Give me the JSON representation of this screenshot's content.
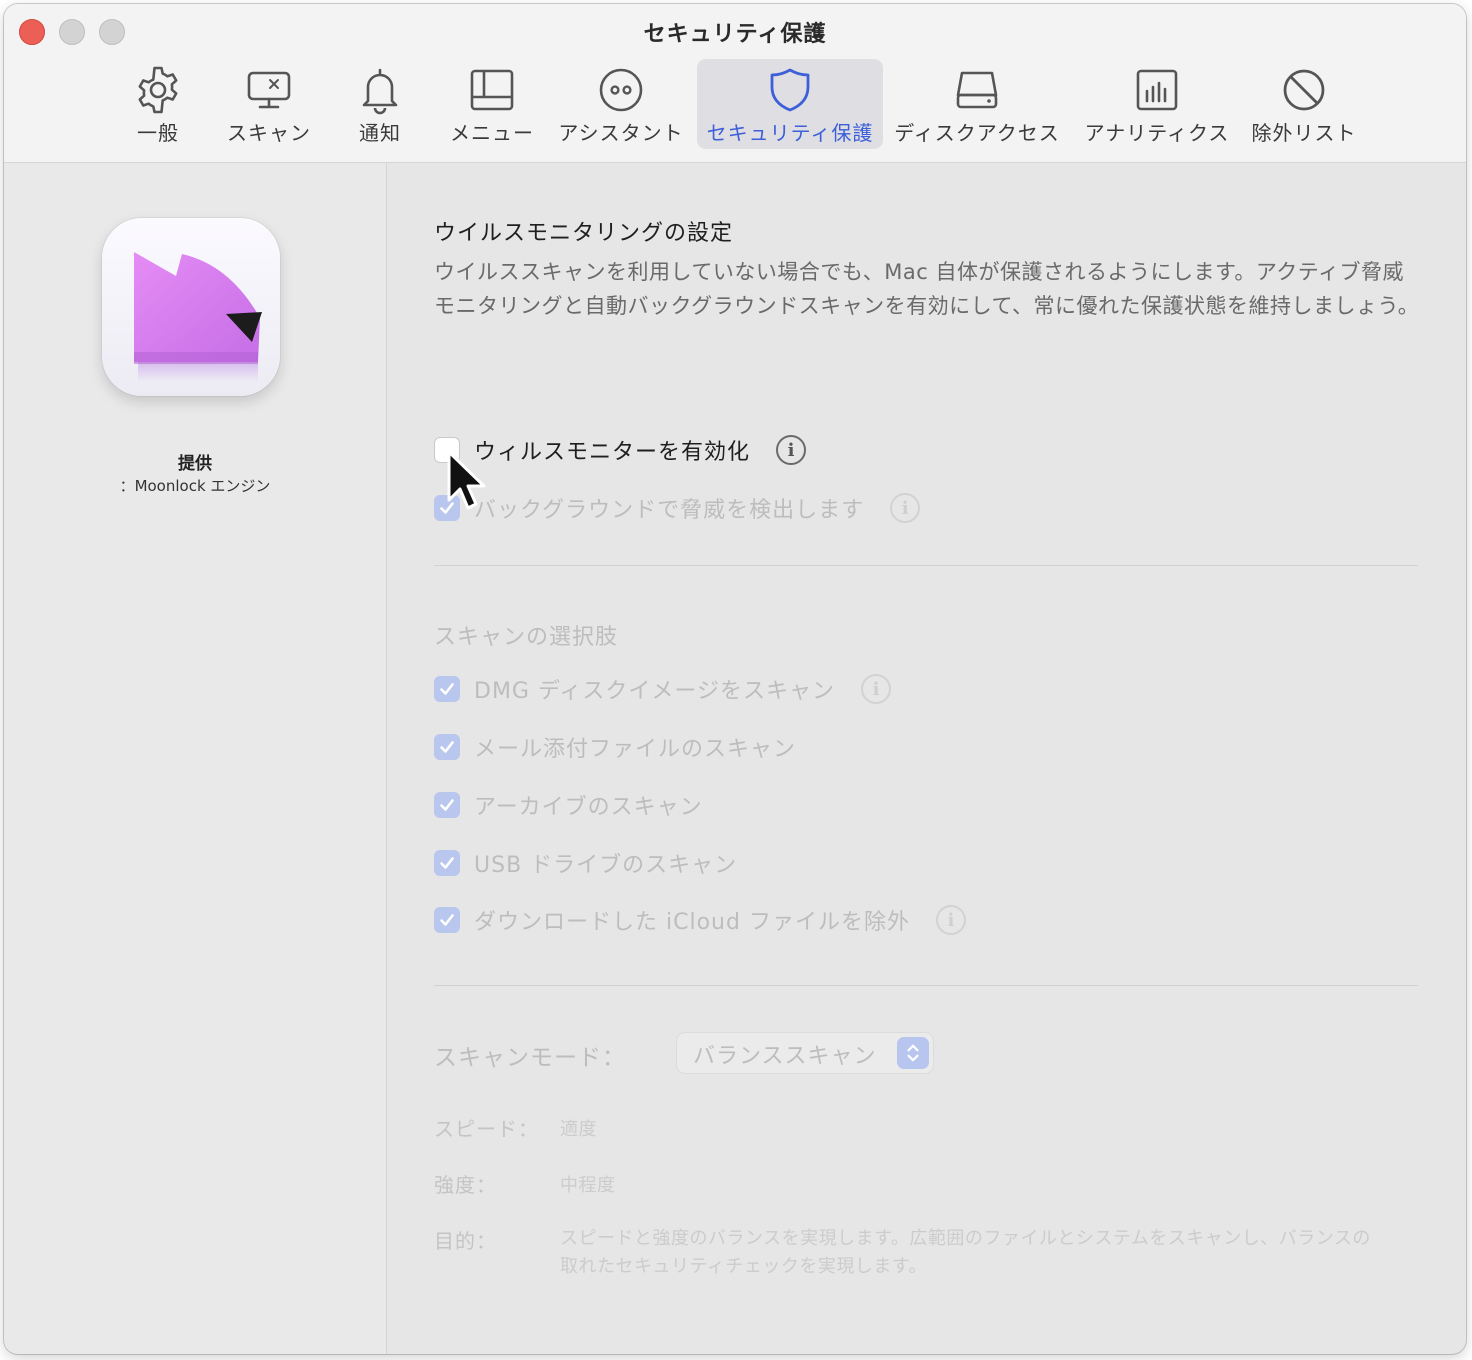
{
  "window": {
    "title": "セキュリティ保護"
  },
  "tabs": [
    {
      "label": "一般",
      "icon": "gear-icon"
    },
    {
      "label": "スキャン",
      "icon": "scan-monitor-icon"
    },
    {
      "label": "通知",
      "icon": "bell-icon"
    },
    {
      "label": "メニュー",
      "icon": "menu-icon"
    },
    {
      "label": "アシスタント",
      "icon": "assistant-icon"
    },
    {
      "label": "セキュリティ保護",
      "icon": "shield-icon",
      "active": true
    },
    {
      "label": "ディスクアクセス",
      "icon": "disk-icon"
    },
    {
      "label": "アナリティクス",
      "icon": "analytics-icon"
    },
    {
      "label": "除外リスト",
      "icon": "prohibited-icon"
    }
  ],
  "sidebar": {
    "provided_label": "提供",
    "provided_engine": "：Moonlock エンジン"
  },
  "virus_monitoring": {
    "title": "ウイルスモニタリングの設定",
    "description": "ウイルススキャンを利用していない場合でも、Mac 自体が保護されるようにします。アクティブ脅威モニタリングと自動バックグラウンドスキャンを有効にして、常に優れた保護状態を維持しましょう。",
    "enable_label": "ウィルスモニターを有効化",
    "enable_checked": false,
    "background_label": "バックグラウンドで脅威を検出します",
    "background_checked": true
  },
  "scan_options": {
    "title": "スキャンの選択肢",
    "items": [
      {
        "label": "DMG ディスクイメージをスキャン",
        "checked": true,
        "info": true
      },
      {
        "label": "メール添付ファイルのスキャン",
        "checked": true,
        "info": false
      },
      {
        "label": "アーカイブのスキャン",
        "checked": true,
        "info": false
      },
      {
        "label": "USB ドライブのスキャン",
        "checked": true,
        "info": false
      },
      {
        "label": "ダウンロードした iCloud ファイルを除外",
        "checked": true,
        "info": true
      }
    ]
  },
  "scan_mode": {
    "label": "スキャンモード：",
    "selected": "バランススキャン",
    "speed_label": "スピード：",
    "speed_value": "適度",
    "strength_label": "強度：",
    "strength_value": "中程度",
    "purpose_label": "目的：",
    "purpose_value": "スピードと強度のバランスを実現します。広範囲のファイルとシステムをスキャンし、バランスの取れたセキュリティチェックを実現します。"
  },
  "colors": {
    "accent": "#3d5fd8",
    "close_button": "#ec5f57",
    "checkbox_disabled": "#b9c6ee",
    "app_icon": "#d97ef0"
  },
  "info_glyph": "i"
}
